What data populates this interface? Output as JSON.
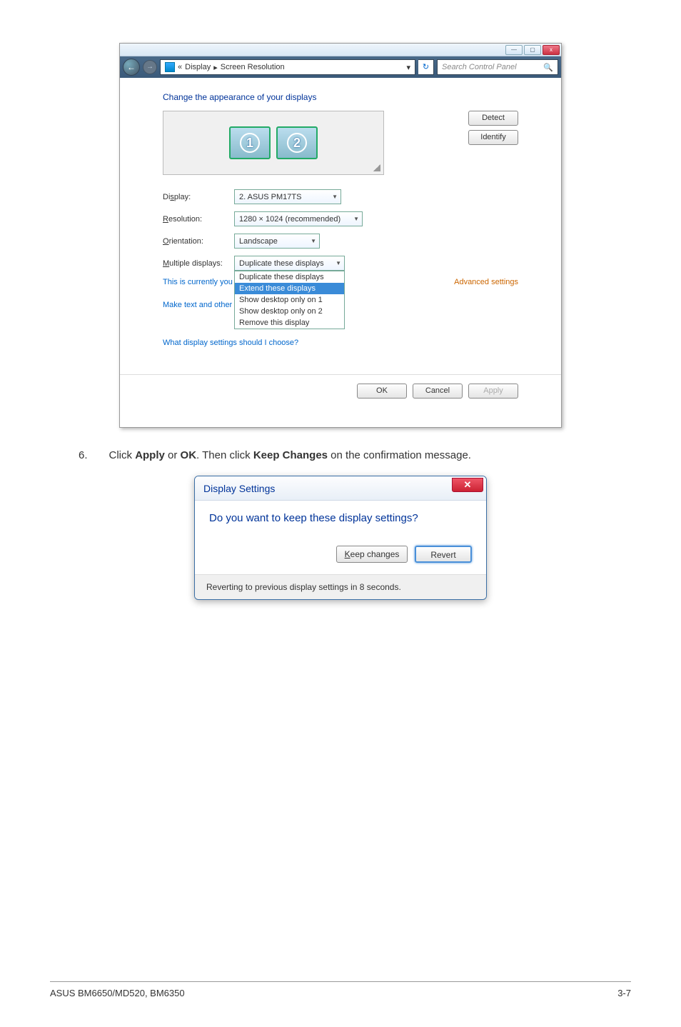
{
  "screenshot1": {
    "window_buttons": {
      "min": "—",
      "max": "▢",
      "close": "x"
    },
    "nav": {
      "back": "←",
      "forward": "→",
      "crumb_sep1": "«",
      "crumb_1": "Display",
      "crumb_sep2": "▸",
      "crumb_2": "Screen Resolution",
      "dropdown_arrow": "▾",
      "refresh": "↻"
    },
    "search_placeholder": "Search Control Panel",
    "search_icon": "🔍",
    "heading": "Change the appearance of your displays",
    "monitor1": "1",
    "monitor2": "2",
    "btn_detect": "Detect",
    "btn_identify": "Identify",
    "rows": {
      "display_label": "Display:",
      "display_value": "2. ASUS PM17TS",
      "resolution_label": "Resolution:",
      "resolution_value": "1280 × 1024 (recommended)",
      "orientation_label": "Orientation:",
      "orientation_value": "Landscape",
      "multiple_label": "Multiple displays:",
      "multiple_value": "Duplicate these displays"
    },
    "dropdown_options": [
      "Duplicate these displays",
      "Extend these displays",
      "Show desktop only on 1",
      "Show desktop only on 2",
      "Remove this display"
    ],
    "dropdown_selected_index": 1,
    "text_behind_left1": "This is currently you",
    "text_behind_left2": "Make text and other",
    "link_what_display": "What display settings should I choose?",
    "link_advanced": "Advanced settings",
    "btn_ok": "OK",
    "btn_cancel": "Cancel",
    "btn_apply": "Apply"
  },
  "instruction": {
    "num": "6.",
    "text_pre": "Click ",
    "bold1": "Apply",
    "text_mid1": " or ",
    "bold2": "OK",
    "text_mid2": ". Then click ",
    "bold3": "Keep Changes",
    "text_post": " on the confirmation message."
  },
  "screenshot2": {
    "title": "Display Settings",
    "close": "✕",
    "main_text": "Do you want to keep these display settings?",
    "btn_keep_k": "K",
    "btn_keep_rest": "eep changes",
    "btn_revert": "Revert",
    "footer": "Reverting to previous display settings in 8 seconds."
  },
  "footer": {
    "left": "ASUS BM6650/MD520, BM6350",
    "right": "3-7"
  }
}
